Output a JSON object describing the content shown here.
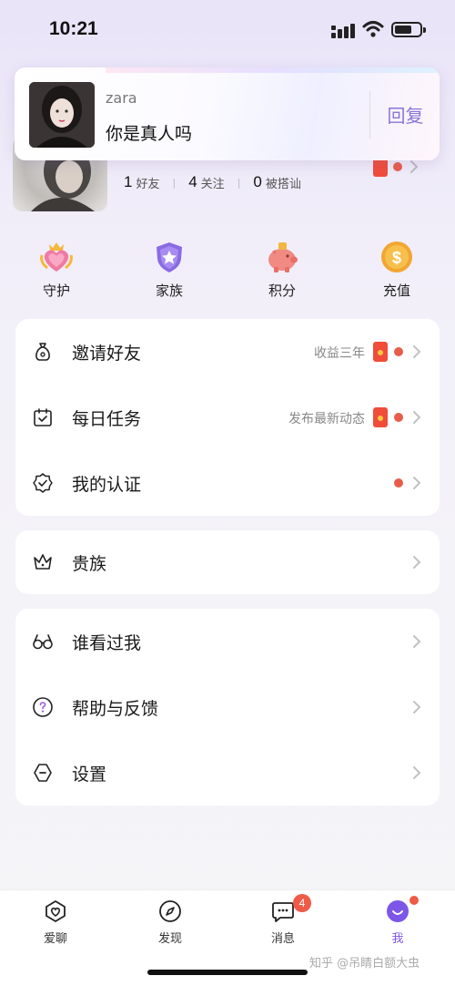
{
  "status_bar": {
    "time": "10:21"
  },
  "notification": {
    "name": "zara",
    "message": "你是真人吗",
    "action": "回复"
  },
  "profile": {
    "stats": [
      {
        "count": "1",
        "label": "好友"
      },
      {
        "count": "4",
        "label": "关注"
      },
      {
        "count": "0",
        "label": "被搭讪"
      }
    ]
  },
  "quick_actions": [
    {
      "label": "守护",
      "icon": "guard-heart-crown-icon"
    },
    {
      "label": "家族",
      "icon": "family-shield-icon"
    },
    {
      "label": "积分",
      "icon": "piggy-bank-icon"
    },
    {
      "label": "充值",
      "icon": "dollar-coin-icon"
    }
  ],
  "menu_group_1": [
    {
      "label": "邀请好友",
      "extra": "收益三年",
      "icon": "money-bag-icon"
    },
    {
      "label": "每日任务",
      "extra": "发布最新动态",
      "icon": "calendar-check-icon"
    },
    {
      "label": "我的认证",
      "extra": "",
      "icon": "badge-check-icon"
    }
  ],
  "menu_group_2": [
    {
      "label": "贵族",
      "icon": "crown-icon"
    }
  ],
  "menu_group_3": [
    {
      "label": "谁看过我",
      "icon": "glasses-icon"
    },
    {
      "label": "帮助与反馈",
      "icon": "help-circle-icon"
    },
    {
      "label": "设置",
      "icon": "settings-hexagon-icon"
    }
  ],
  "tabbar": [
    {
      "label": "爱聊",
      "icon": "heart-chat-icon"
    },
    {
      "label": "发现",
      "icon": "compass-icon"
    },
    {
      "label": "消息",
      "icon": "message-icon",
      "badge": "4"
    },
    {
      "label": "我",
      "icon": "me-smile-icon",
      "active": true
    }
  ],
  "watermark": "知乎 @吊睛白额大虫",
  "colors": {
    "accent": "#7d56e8",
    "reply": "#8b74d9",
    "badge": "#ef5b46"
  }
}
